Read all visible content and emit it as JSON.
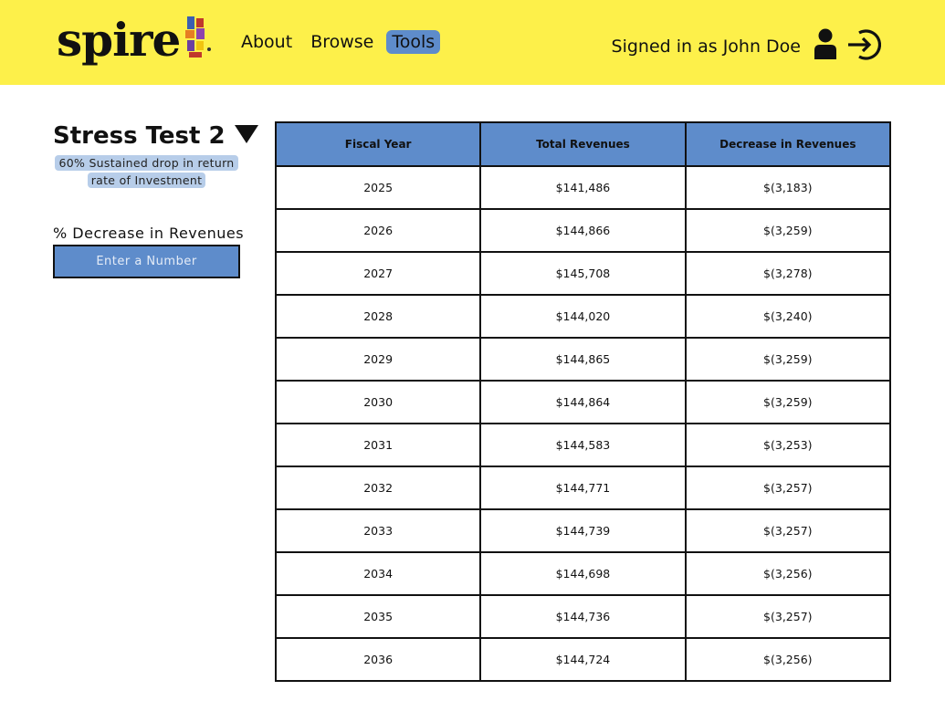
{
  "brand": {
    "name": "spire"
  },
  "nav": {
    "items": [
      {
        "label": "About",
        "active": false
      },
      {
        "label": "Browse",
        "active": false
      },
      {
        "label": "Tools",
        "active": true
      }
    ]
  },
  "user": {
    "signed_in_text": "Signed in as John Doe",
    "icons": [
      "user-icon",
      "sign-in-icon"
    ]
  },
  "sidebar": {
    "title": "Stress Test 2",
    "dropdown_icon": "triangle-down-icon",
    "description": "60% Sustained drop in return rate of Investment",
    "field_label": "% Decrease in Revenues",
    "input_placeholder": "Enter a Number",
    "input_value": ""
  },
  "table": {
    "headers": [
      "Fiscal Year",
      "Total Revenues",
      "Decrease in Revenues"
    ],
    "rows": [
      [
        "2025",
        "$141,486",
        "$(3,183)"
      ],
      [
        "2026",
        "$144,866",
        "$(3,259)"
      ],
      [
        "2027",
        "$145,708",
        "$(3,278)"
      ],
      [
        "2028",
        "$144,020",
        "$(3,240)"
      ],
      [
        "2029",
        "$144,865",
        "$(3,259)"
      ],
      [
        "2030",
        "$144,864",
        "$(3,259)"
      ],
      [
        "2031",
        "$144,583",
        "$(3,253)"
      ],
      [
        "2032",
        "$144,771",
        "$(3,257)"
      ],
      [
        "2033",
        "$144,739",
        "$(3,257)"
      ],
      [
        "2034",
        "$144,698",
        "$(3,256)"
      ],
      [
        "2035",
        "$144,736",
        "$(3,257)"
      ],
      [
        "2036",
        "$144,724",
        "$(3,256)"
      ]
    ]
  },
  "colors": {
    "header_bg": "#fdf04a",
    "accent_blue": "#5e8ccb",
    "tag_bg": "#b7cde9"
  }
}
